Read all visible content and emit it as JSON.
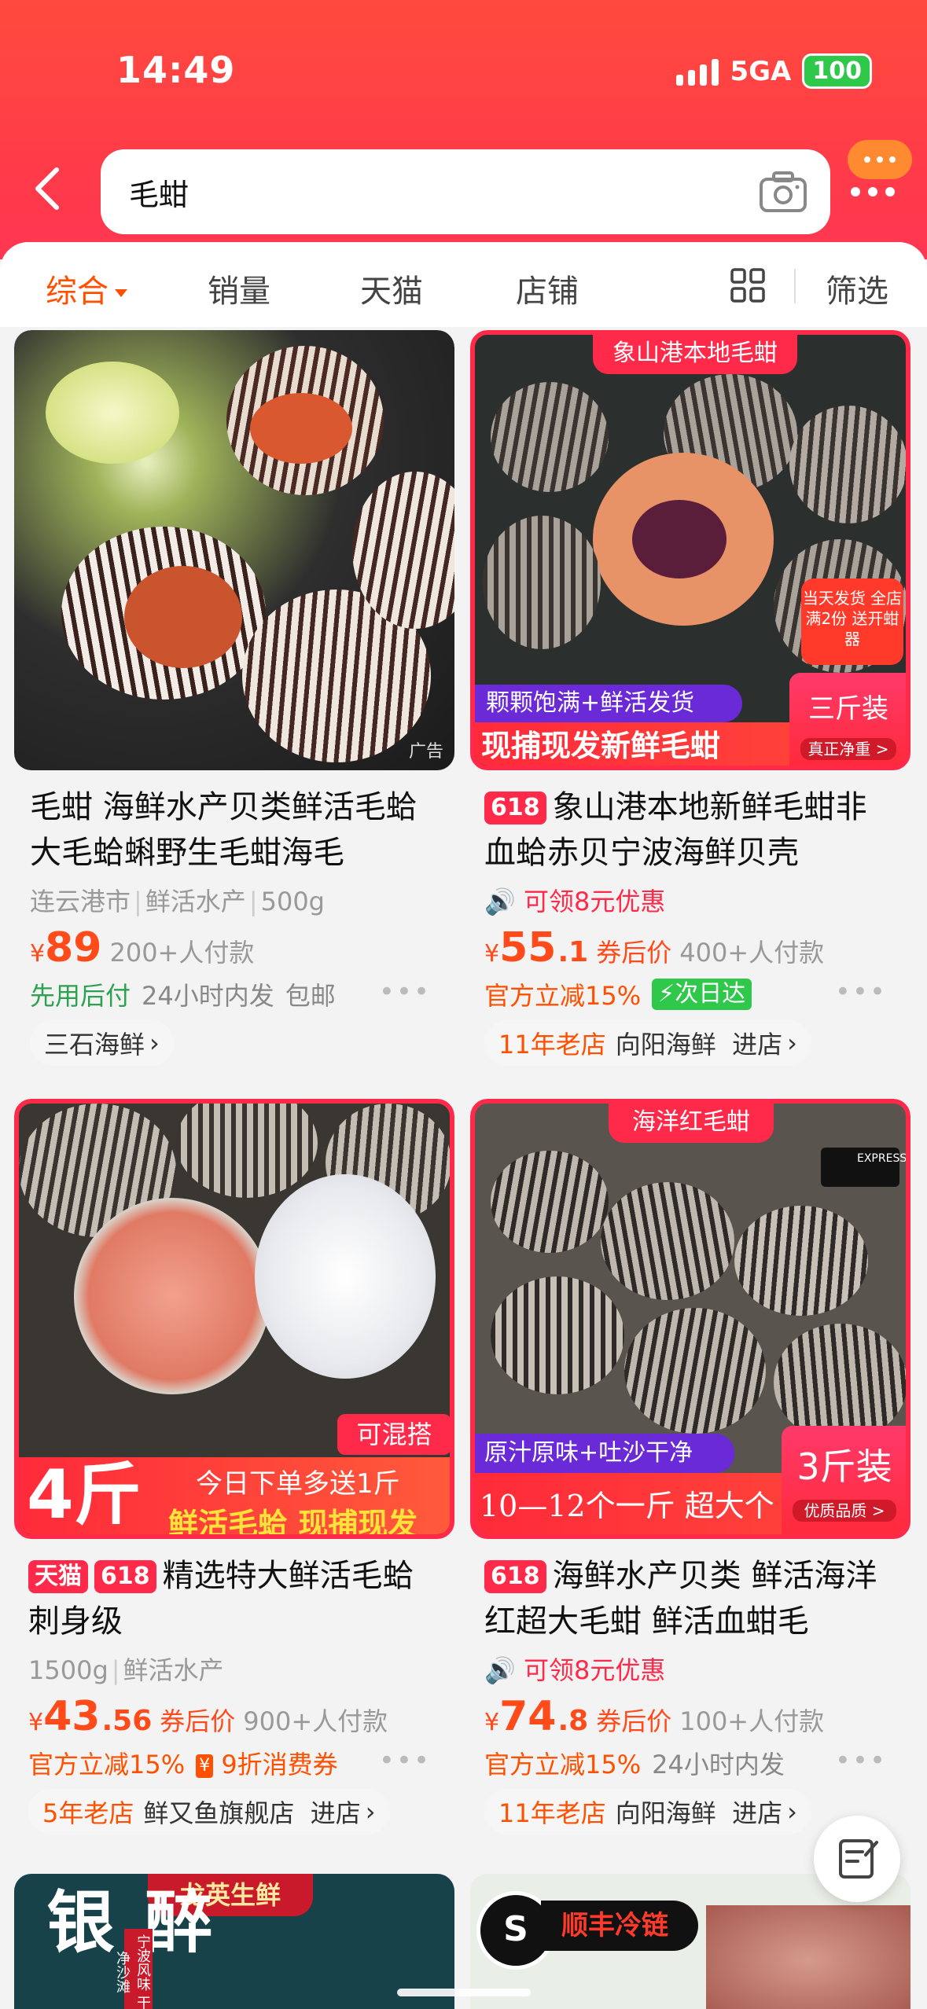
{
  "status": {
    "time": "14:49",
    "network": "5GA",
    "battery": "100"
  },
  "search": {
    "query": "毛蚶"
  },
  "tabs": {
    "comprehensive": "综合",
    "sales": "销量",
    "tmall": "天猫",
    "stores": "店铺",
    "filter": "筛选"
  },
  "colors": {
    "brand": "#ff4a3d",
    "price": "#ff4a1a",
    "tag": "#ff2a4a",
    "green": "#2ca14f"
  },
  "products": [
    {
      "title": "毛蚶  海鲜水产贝类鲜活毛蛤大毛蛤蝌野生毛蚶海毛",
      "attrs": [
        "连云港市",
        "鲜活水产",
        "500g"
      ],
      "yen": "¥",
      "price": "89",
      "price_dec": "",
      "coupon": "",
      "sold": "200+人付款",
      "service": [
        "先用后付",
        "24小时内发",
        "包邮"
      ],
      "shop": "三石海鲜",
      "ad": "广告"
    },
    {
      "tag": "618",
      "title": "象山港本地新鲜毛蚶非血蛤赤贝宁波海鲜贝壳",
      "banner_top": "象山港本地毛蚶",
      "banner_a": "颗颗饱满+鲜活发货",
      "banner_b": "现捕现发新鲜毛蚶",
      "badge": "三斤装",
      "badge_sub": "真正净重 >",
      "corner": "当天发货 全店满2份 送开蚶器",
      "promo": "可领8元优惠",
      "yen": "¥",
      "price": "55",
      "price_dec": ".1",
      "coupon": "券后价",
      "sold": "400+人付款",
      "service": [
        "官方立减15%",
        "次日达"
      ],
      "shop_age": "11年老店",
      "shop": "向阳海鲜",
      "shop_action": "进店"
    },
    {
      "tags": [
        "天猫",
        "618"
      ],
      "title": "精选特大鲜活毛蛤刺身级",
      "attrs": [
        "1500g",
        "鲜活水产"
      ],
      "big": "4斤",
      "mix": "可混搭",
      "banner_a": "今日下单多送1斤",
      "banner_b": "鲜活毛蛤 现捕现发",
      "yen": "¥",
      "price": "43",
      "price_dec": ".56",
      "coupon": "券后价",
      "sold": "900+人付款",
      "service": [
        "官方立减15%",
        "9折消费券"
      ],
      "shop_age": "5年老店",
      "shop": "鲜又鱼旗舰店",
      "shop_action": "进店"
    },
    {
      "tag": "618",
      "title": "海鲜水产贝类 鲜活海洋红超大毛蚶 鲜活血蚶毛",
      "banner_top": "海洋红毛蚶",
      "banner_a": "原汁原味+吐沙干净",
      "banner_b": "10—12个一斤  超大个",
      "badge": "3斤装",
      "badge_sub": "优质品质 >",
      "express": "EXPRESS",
      "promo": "可领8元优惠",
      "yen": "¥",
      "price": "74",
      "price_dec": ".8",
      "coupon": "券后价",
      "sold": "100+人付款",
      "service": [
        "官方立减15%",
        "24小时内发"
      ],
      "shop_age": "11年老店",
      "shop": "向阳海鲜",
      "shop_action": "进店"
    }
  ],
  "next_row": {
    "left_banner": "龙英生鲜",
    "left_text": "醉银",
    "left_side": "宁波风味 干净沙滩",
    "right_banner": "顺丰冷链"
  }
}
